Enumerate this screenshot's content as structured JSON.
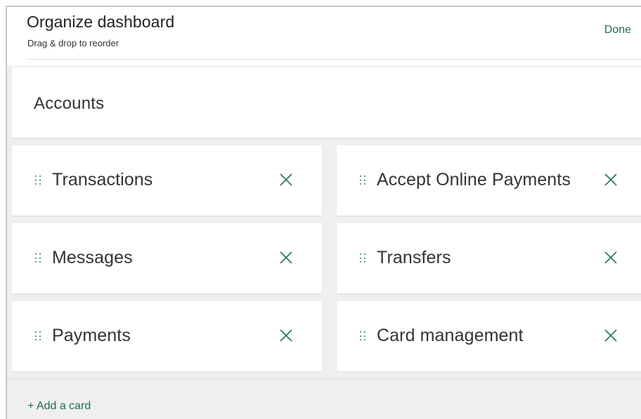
{
  "header": {
    "title": "Organize dashboard",
    "subtitle": "Drag & drop to reorder",
    "done_label": "Done"
  },
  "accounts": {
    "label": "Accounts"
  },
  "cards": [
    {
      "label": "Transactions"
    },
    {
      "label": "Accept Online Payments"
    },
    {
      "label": "Messages"
    },
    {
      "label": "Transfers"
    },
    {
      "label": "Payments"
    },
    {
      "label": "Card management"
    }
  ],
  "footer": {
    "add_card_label": "+ Add a card"
  },
  "colors": {
    "accent": "#1f6b5b",
    "background": "#efefef",
    "card": "#ffffff"
  },
  "icons": {
    "drag": "drag-handle-icon",
    "remove": "close-icon"
  }
}
